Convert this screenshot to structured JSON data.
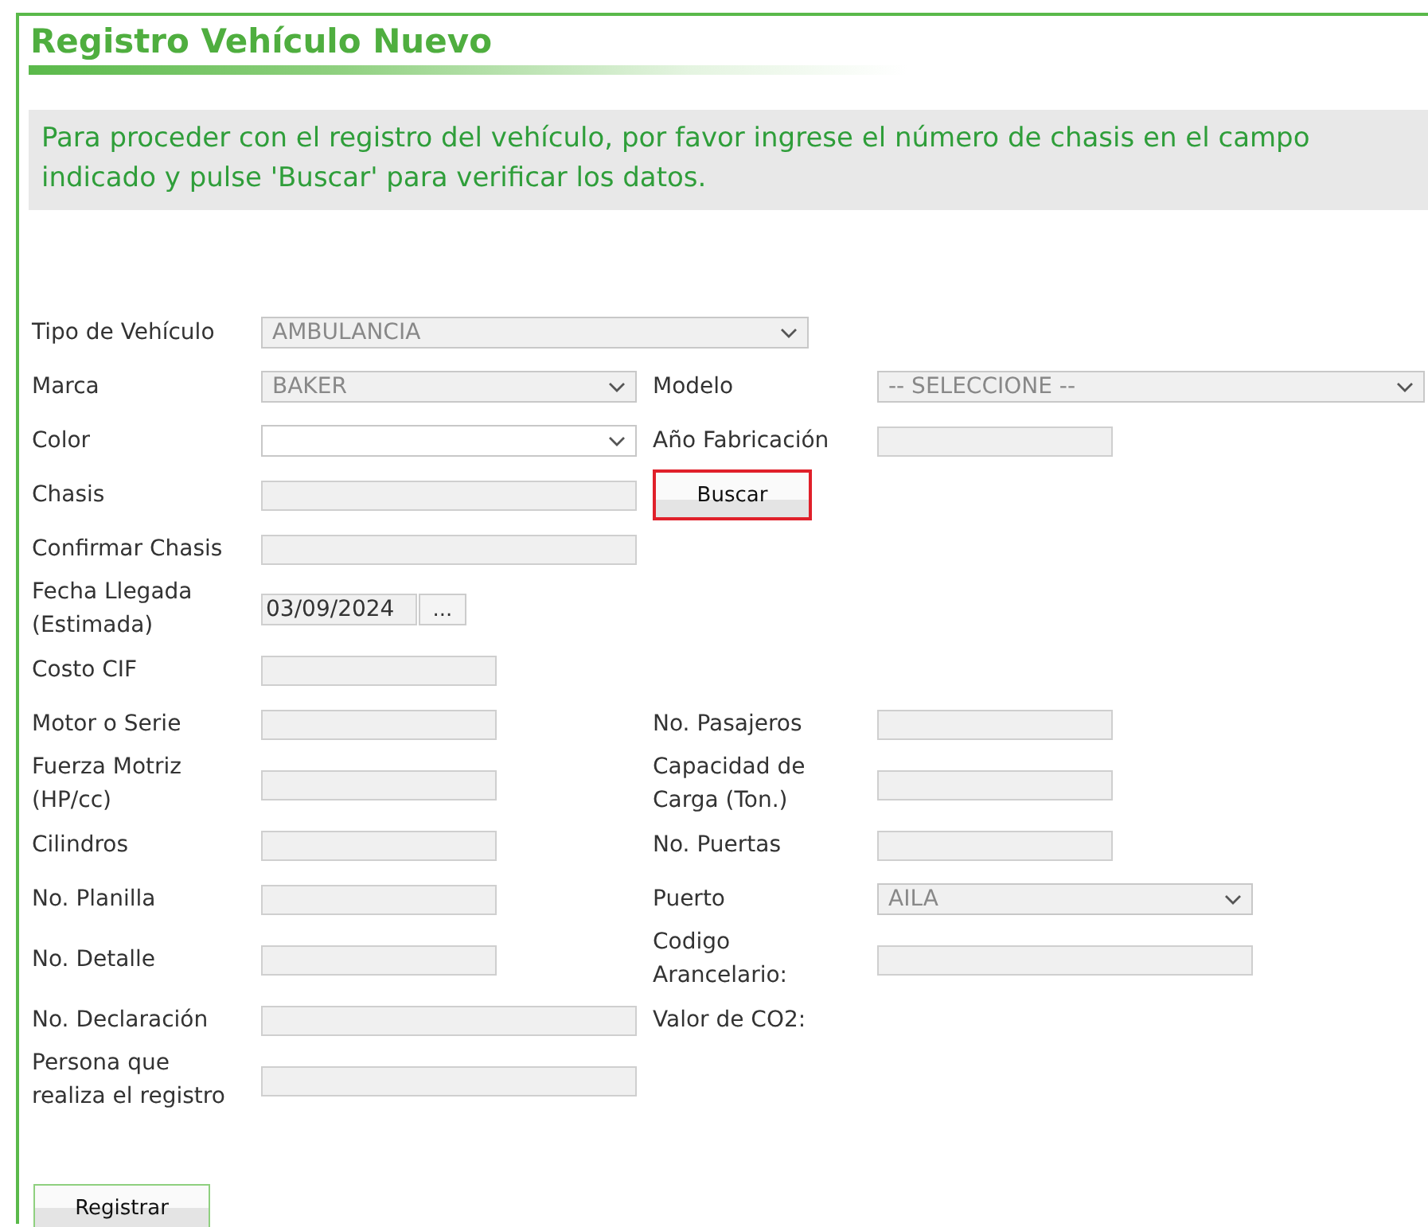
{
  "title": "Registro Vehículo Nuevo",
  "instructions": "Para proceder con el registro del vehículo, por favor ingrese el número de chasis en el campo indicado y pulse 'Buscar' para verificar los datos.",
  "rows": [
    {
      "left": {
        "label": "Tipo de Vehículo",
        "field": {
          "kind": "wideselect",
          "value": "AMBULANCIA",
          "disabled": true
        }
      }
    },
    {
      "left": {
        "label": "Marca",
        "field": {
          "kind": "select",
          "value": "BAKER",
          "disabled": true
        }
      },
      "right": {
        "label": "Modelo",
        "field": {
          "kind": "wideselect",
          "value": "-- SELECCIONE --",
          "disabled": true
        }
      }
    },
    {
      "left": {
        "label": "Color",
        "field": {
          "kind": "select",
          "disabled": false
        }
      },
      "right": {
        "label": "Año Fabricación",
        "field": {
          "kind": "shortinput"
        }
      }
    },
    {
      "left": {
        "label": "Chasis",
        "field": {
          "kind": "input"
        }
      },
      "right": {
        "field": {
          "kind": "button",
          "label": "Buscar",
          "highlighted": true
        }
      }
    },
    {
      "left": {
        "label": "Confirmar Chasis",
        "field": {
          "kind": "input"
        }
      }
    },
    {
      "left": {
        "label": "Fecha Llegada (Estimada)",
        "field": {
          "kind": "date",
          "value": "03/09/2024",
          "button": "..."
        }
      }
    },
    {
      "left": {
        "label": "Costo CIF",
        "field": {
          "kind": "shortinput"
        }
      }
    },
    {
      "left": {
        "label": "Motor o Serie",
        "field": {
          "kind": "shortinput"
        }
      },
      "right": {
        "label": "No. Pasajeros",
        "field": {
          "kind": "shortinput"
        }
      }
    },
    {
      "left": {
        "label": "Fuerza Motriz (HP/cc)",
        "field": {
          "kind": "shortinput"
        }
      },
      "right": {
        "label": "Capacidad de Carga (Ton.)",
        "field": {
          "kind": "shortinput"
        }
      }
    },
    {
      "left": {
        "label": "Cilindros",
        "field": {
          "kind": "shortinput"
        }
      },
      "right": {
        "label": "No. Puertas",
        "field": {
          "kind": "shortinput"
        }
      }
    },
    {
      "left": {
        "label": "No. Planilla",
        "field": {
          "kind": "shortinput"
        }
      },
      "right": {
        "label": "Puerto",
        "field": {
          "kind": "select",
          "value": "AILA",
          "disabled": true
        }
      }
    },
    {
      "left": {
        "label": "No. Detalle",
        "field": {
          "kind": "shortinput"
        }
      },
      "right": {
        "label": "Codigo Arancelario:",
        "field": {
          "kind": "input"
        }
      }
    },
    {
      "left": {
        "label": "No. Declaración",
        "field": {
          "kind": "input"
        }
      },
      "right": {
        "label": "Valor de CO2:"
      }
    },
    {
      "left": {
        "label": "Persona que realiza el registro",
        "field": {
          "kind": "input"
        }
      }
    }
  ],
  "submit": "Registrar"
}
